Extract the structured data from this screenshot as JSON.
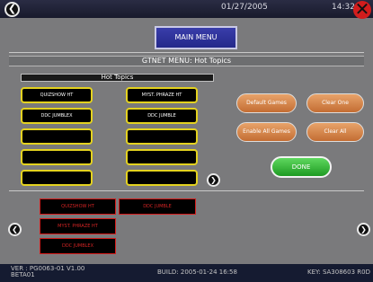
{
  "header": {
    "date": "01/27/2005",
    "time": "14:32",
    "back_icon": "chevron-left-icon",
    "close_icon": "close-x-icon"
  },
  "main_menu_label": "MAIN MENU",
  "gtnet_title": "GTNET MENU: Hot Topics",
  "hot_topics": {
    "title": "Hot Topics",
    "left": [
      "QUIZSHOW HT",
      "DDC JUMBLEX",
      "",
      "",
      ""
    ],
    "right": [
      "MYST. PHRAZE HT",
      "DDC JUMBLE",
      "",
      "",
      ""
    ]
  },
  "actions": {
    "default_games": "Default Games",
    "clear_one": "Clear One",
    "enable_all": "Enable All Games",
    "clear_all": "Clear All",
    "done": "DONE"
  },
  "available": [
    "QUIZSHOW HT",
    "DDC JUMBLE",
    "MYST. PHRAZE HT",
    "DDC JUMBLEX"
  ],
  "footer": {
    "ver_line1": "VER : PG0063-01 V1.00",
    "ver_line2": "BETA01",
    "build": "BUILD: 2005-01-24 16:58",
    "key": "KEY: SA308603 R0D"
  },
  "colors": {
    "slot_border": "#e4d21f",
    "done_green": "#2fb82f",
    "action_orange": "#d9874b",
    "unavailable_red": "#d41b1b"
  }
}
